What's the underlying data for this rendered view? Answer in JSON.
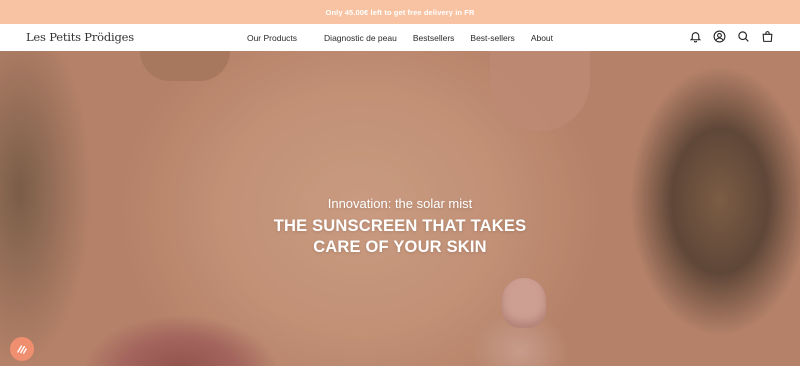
{
  "announcement": {
    "text": "Only 45.00€ left to get free delivery in FR"
  },
  "header": {
    "logo": "Les Petits Prödiges",
    "nav": [
      {
        "label": "Our Products"
      },
      {
        "label": "Diagnostic de peau"
      },
      {
        "label": "Bestsellers"
      },
      {
        "label": "Best-sellers"
      },
      {
        "label": "About"
      }
    ],
    "icons": [
      "bell-icon",
      "account-icon",
      "search-icon",
      "cart-icon"
    ]
  },
  "hero": {
    "subtitle": "Innovation: the solar mist",
    "title_line1": "THE SUNSCREEN THAT TAKES",
    "title_line2": "CARE OF YOUR SKIN"
  },
  "badge": {
    "icon": "loyalty-badge-icon",
    "color": "#f08f6f"
  },
  "colors": {
    "announcement_bg": "#f8c3a2",
    "accent": "#f08f6f"
  }
}
